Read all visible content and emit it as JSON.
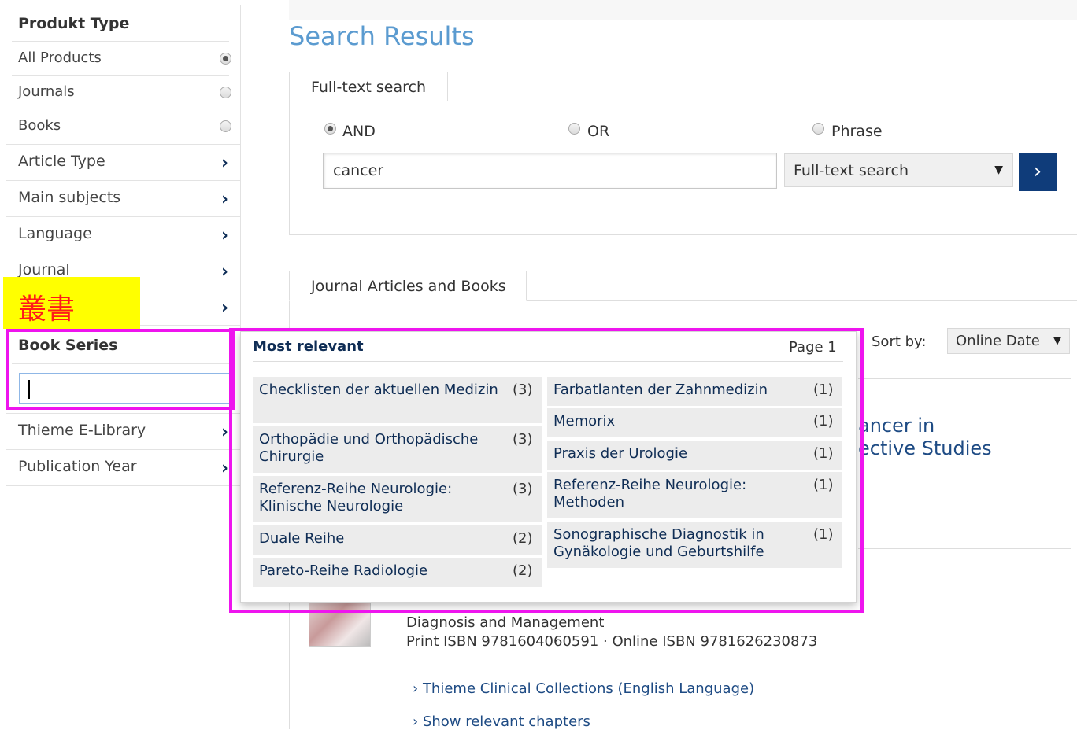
{
  "sidebar": {
    "produkt_type_heading": "Produkt Type",
    "product_options": [
      {
        "label": "All Products",
        "selected": true
      },
      {
        "label": "Journals",
        "selected": false
      },
      {
        "label": "Books",
        "selected": false
      }
    ],
    "filters": [
      "Article Type",
      "Main subjects",
      "Language",
      "Journal"
    ],
    "book_series": {
      "heading": "Book Series",
      "input_value": ""
    },
    "more_filters": [
      "Thieme E-Library",
      "Publication Year"
    ]
  },
  "main": {
    "title": "Search Results",
    "search_tab": "Full-text search",
    "mode_options": [
      {
        "label": "AND",
        "selected": true
      },
      {
        "label": "OR",
        "selected": false
      },
      {
        "label": "Phrase",
        "selected": false
      }
    ],
    "search_value": "cancer",
    "search_type": "Full-text search",
    "results_tab": "Journal Articles and Books",
    "sort_label": "Sort by:",
    "sort_value": "Online Date",
    "partial_title_1": "ancer in",
    "partial_title_2": "ective Studies",
    "book_subtitle": "Diagnosis and Management",
    "book_isbn": "Print ISBN 9781604060591 · Online ISBN 9781626230873",
    "link_1": "Thieme Clinical Collections (English Language)",
    "link_2": "Show relevant chapters"
  },
  "dropdown": {
    "heading": "Most relevant",
    "page": "Page 1",
    "left_items": [
      {
        "name": "Checklisten der aktuellen Medizin",
        "count": "(3)"
      },
      {
        "name": "Orthopädie und Orthopädische Chirurgie",
        "count": "(3)"
      },
      {
        "name": "Referenz-Reihe Neurologie: Klinische Neurologie",
        "count": "(3)"
      },
      {
        "name": "Duale Reihe",
        "count": "(2)"
      },
      {
        "name": "Pareto-Reihe Radiologie",
        "count": "(2)"
      }
    ],
    "right_items": [
      {
        "name": "Farbatlanten der Zahnmedizin",
        "count": "(1)"
      },
      {
        "name": "Memorix",
        "count": "(1)"
      },
      {
        "name": "Praxis der Urologie",
        "count": "(1)"
      },
      {
        "name": "Referenz-Reihe Neurologie: Methoden",
        "count": "(1)"
      },
      {
        "name": "Sonographische Diagnostik in Gynäkologie und Geburtshilfe",
        "count": "(1)"
      }
    ]
  },
  "annotation": {
    "label": "叢書",
    "highlight_color": "#ee14ee",
    "label_bg": "#ffff00",
    "label_color": "#ff1a1a"
  },
  "colors": {
    "title": "#5b9bd0",
    "link": "#1e4b84",
    "button": "#0f3c7a"
  }
}
